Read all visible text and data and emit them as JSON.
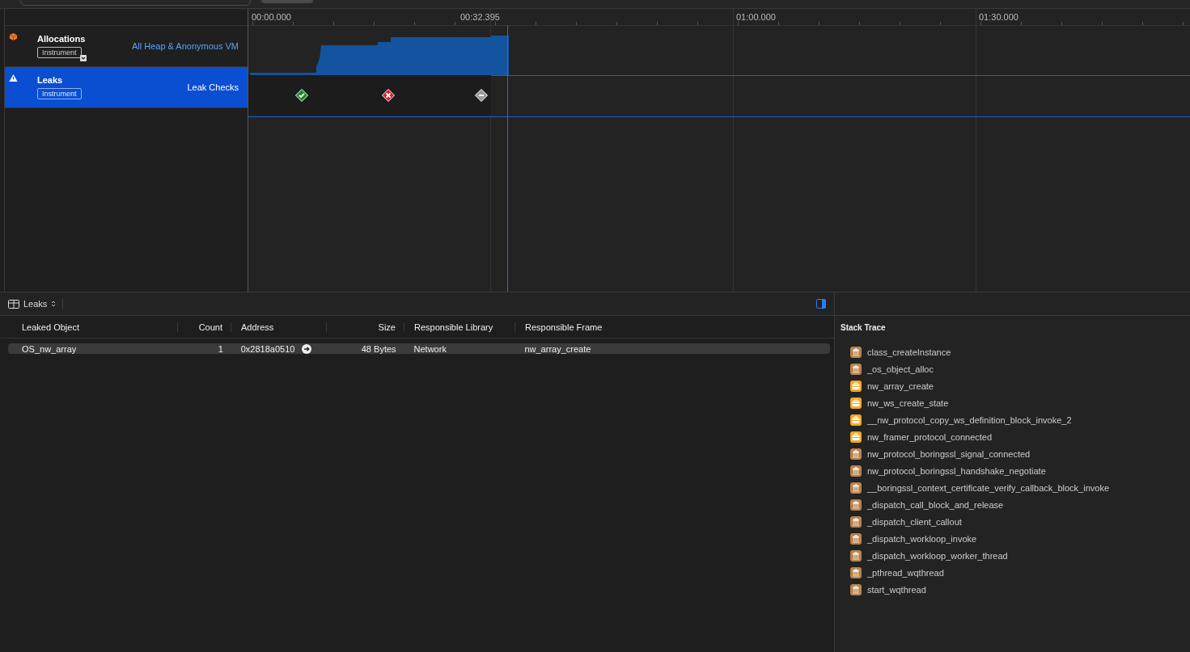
{
  "timeline": {
    "ticks": [
      {
        "label": "00:00.000"
      },
      {
        "label": "01:00.000"
      },
      {
        "label": "01:30.000"
      }
    ],
    "playhead": {
      "label": "00:32.395"
    }
  },
  "tracks": [
    {
      "name": "Allocations",
      "badge": "Instrument",
      "detail": "All Heap & Anonymous VM",
      "kind": "allocations",
      "selected": false
    },
    {
      "name": "Leaks",
      "badge": "Instrument",
      "detail": "Leak Checks",
      "kind": "leaks",
      "selected": true,
      "checks": [
        {
          "kind": "pass"
        },
        {
          "kind": "leak"
        },
        {
          "kind": "none"
        }
      ]
    }
  ],
  "detail_panel": {
    "selector": "Leaks",
    "columns": [
      {
        "label": "Leaked Object"
      },
      {
        "label": "Count"
      },
      {
        "label": "Address"
      },
      {
        "label": "Size"
      },
      {
        "label": "Responsible Library"
      },
      {
        "label": "Responsible Frame"
      }
    ],
    "rows": [
      {
        "cells": [
          "OS_nw_array",
          "1",
          "0x2818a0510",
          "48 Bytes",
          "Network",
          "nw_array_create"
        ],
        "selected": true
      }
    ]
  },
  "inspector": {
    "title": "Stack Trace",
    "frames": [
      {
        "name": "class_createInstance",
        "kind": "system"
      },
      {
        "name": "_os_object_alloc",
        "kind": "system"
      },
      {
        "name": "nw_array_create",
        "kind": "framework"
      },
      {
        "name": "nw_ws_create_state",
        "kind": "framework"
      },
      {
        "name": "__nw_protocol_copy_ws_definition_block_invoke_2",
        "kind": "framework"
      },
      {
        "name": "nw_framer_protocol_connected",
        "kind": "framework"
      },
      {
        "name": "nw_protocol_boringssl_signal_connected",
        "kind": "system"
      },
      {
        "name": "nw_protocol_boringssl_handshake_negotiate",
        "kind": "system"
      },
      {
        "name": "__boringssl_context_certificate_verify_callback_block_invoke",
        "kind": "system"
      },
      {
        "name": "_dispatch_call_block_and_release",
        "kind": "system"
      },
      {
        "name": "_dispatch_client_callout",
        "kind": "system"
      },
      {
        "name": "_dispatch_workloop_invoke",
        "kind": "system"
      },
      {
        "name": "_dispatch_workloop_worker_thread",
        "kind": "system"
      },
      {
        "name": "_pthread_wqthread",
        "kind": "system"
      },
      {
        "name": "start_wqthread",
        "kind": "system"
      }
    ]
  }
}
